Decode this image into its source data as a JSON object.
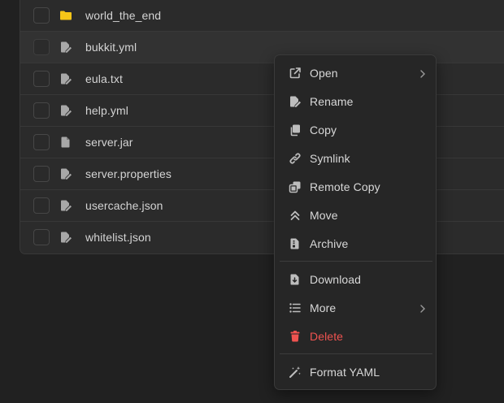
{
  "files": [
    {
      "name": "world_the_end",
      "icon": "folder-icon"
    },
    {
      "name": "bukkit.yml",
      "icon": "file-edit-icon"
    },
    {
      "name": "eula.txt",
      "icon": "file-edit-icon"
    },
    {
      "name": "help.yml",
      "icon": "file-edit-icon"
    },
    {
      "name": "server.jar",
      "icon": "file-icon"
    },
    {
      "name": "server.properties",
      "icon": "file-edit-icon"
    },
    {
      "name": "usercache.json",
      "icon": "file-edit-icon"
    },
    {
      "name": "whitelist.json",
      "icon": "file-edit-icon"
    }
  ],
  "context_menu": {
    "items": [
      {
        "label": "Open",
        "icon": "external-link-icon",
        "has_submenu": true
      },
      {
        "label": "Rename",
        "icon": "file-edit-icon"
      },
      {
        "label": "Copy",
        "icon": "copy-icon"
      },
      {
        "label": "Symlink",
        "icon": "link-icon"
      },
      {
        "label": "Remote Copy",
        "icon": "remote-copy-icon"
      },
      {
        "label": "Move",
        "icon": "move-icon"
      },
      {
        "label": "Archive",
        "icon": "archive-icon"
      },
      {
        "label": "Download",
        "icon": "download-icon"
      },
      {
        "label": "More",
        "icon": "list-icon",
        "has_submenu": true
      },
      {
        "label": "Delete",
        "icon": "trash-icon",
        "danger": true
      },
      {
        "label": "Format YAML",
        "icon": "magic-wand-icon"
      }
    ]
  },
  "colors": {
    "background": "#212121",
    "panel": "#2b2b2b",
    "selected_row": "#323232",
    "folder": "#f5c518",
    "danger": "#ef5350",
    "text": "#d4d4d4",
    "icon": "#a8a8a8"
  }
}
